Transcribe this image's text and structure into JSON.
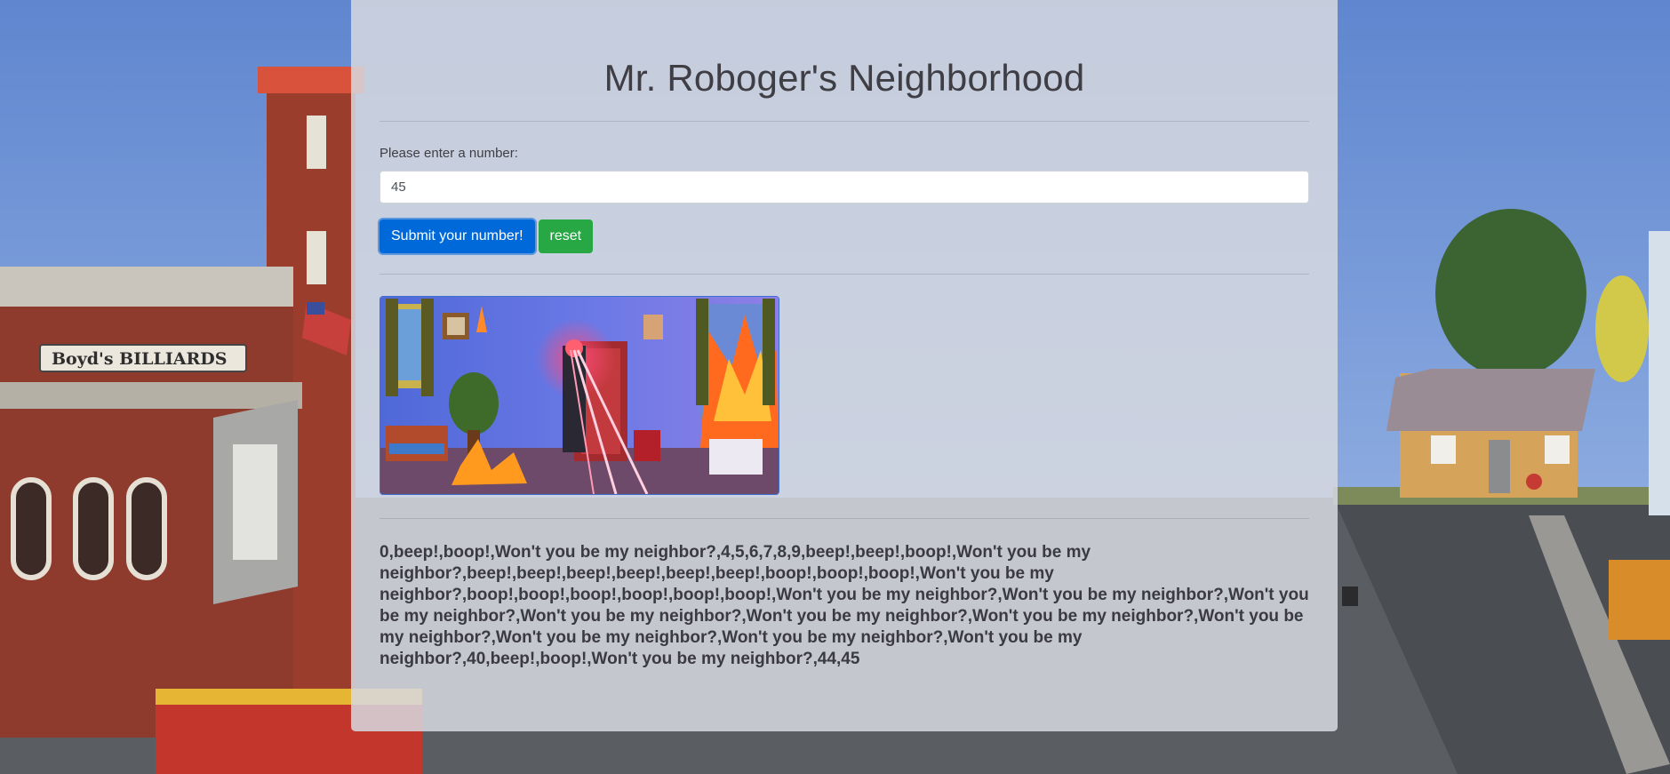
{
  "page": {
    "title": "Mr. Roboger's Neighborhood"
  },
  "form": {
    "label": "Please enter a number:",
    "input_value": "45",
    "submit_label": "Submit your number!",
    "reset_label": "reset"
  },
  "result": {
    "text": "0,beep!,boop!,Won't you be my neighbor?,4,5,6,7,8,9,beep!,beep!,boop!,Won't you be my neighbor?,beep!,beep!,beep!,beep!,beep!,beep!,boop!,boop!,boop!,Won't you be my neighbor?,boop!,boop!,boop!,boop!,boop!,boop!,Won't you be my neighbor?,Won't you be my neighbor?,Won't you be my neighbor?,Won't you be my neighbor?,Won't you be my neighbor?,Won't you be my neighbor?,Won't you be my neighbor?,Won't you be my neighbor?,Won't you be my neighbor?,Won't you be my neighbor?,40,beep!,boop!,Won't you be my neighbor?,44,45"
  },
  "background": {
    "sign_text": "Boyd's BILLIARDS"
  },
  "colors": {
    "primary": "#0069d9",
    "success": "#28a745",
    "panel": "#d6d9df",
    "title_text": "#3e3e44"
  }
}
